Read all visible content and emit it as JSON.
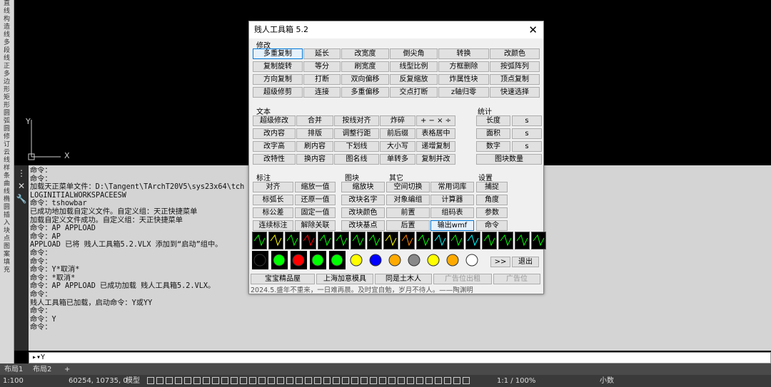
{
  "left_strip": [
    "直",
    "线",
    "构",
    "造",
    "线",
    "多",
    "段",
    "线",
    "正",
    "多",
    "边",
    "形",
    "矩",
    "形",
    "圆",
    "弧",
    "圆",
    "修",
    "订",
    "云",
    "线",
    "样",
    "条",
    "曲",
    "线",
    "椭",
    "圆",
    "插",
    "入",
    "块",
    "点",
    "图",
    "案",
    "填",
    "充"
  ],
  "ucs": {
    "y": "Y",
    "x": "X"
  },
  "cmd_log": [
    "命令：",
    "命令：",
    "加载天正菜单文件：D:\\Tangent\\TArchT20V5\\sys23x64\\tch",
    "LOGINITIALWORKSPACEESW",
    "命令：tshowbar",
    "已成功地加载自定义文件。自定义组：天正快捷菜单",
    "加载自定义文件成功。自定义组：天正快捷菜单",
    "命令：AP APPLOAD",
    "命令：AP",
    "APPLOAD 已将 贱人工具箱5.2.VLX 添加到“启动”组中。",
    "命令：",
    "命令：",
    "命令：Y*取消*",
    "命令：*取消*",
    "命令：AP APPLOAD 已成功加载 贱人工具箱5.2.VLX。",
    "命令：",
    "贱人工具箱已加载，启动命令：Y或YY",
    "命令：",
    "命令：Y",
    "命令："
  ],
  "cmd_input": "Y",
  "layout_tabs": [
    "布局1",
    "布局2",
    "+"
  ],
  "status": {
    "scale": "1:100",
    "coords": "60254, 10735, 0",
    "model": "模型",
    "zoom": "1:1 / 100%",
    "decimal": "小数"
  },
  "dialog": {
    "title": "贱人工具箱 5.2",
    "close": "✕",
    "sections": {
      "modify": "修改",
      "text": "文本",
      "stats": "统计",
      "annot": "标注",
      "block": "图块",
      "other": "其它",
      "settings": "设置"
    },
    "modify": [
      "多重复制",
      "延长",
      "改宽度",
      "倒尖角",
      "转换",
      "改颜色",
      "复制旋转",
      "等分",
      "刷宽度",
      "线型比例",
      "方框删除",
      "按弧阵列",
      "方向复制",
      "打断",
      "双向偏移",
      "反复缩放",
      "炸属性块",
      "顶点复制",
      "超级修剪",
      "连接",
      "多重偏移",
      "交点打断",
      "z轴归零",
      "快速选择"
    ],
    "text": [
      "超级修改",
      "合并",
      "按线对齐",
      "炸碎",
      "+ − × ÷",
      "改内容",
      "排版",
      "调整行距",
      "前后缀",
      "表格居中",
      "改字高",
      "刷内容",
      "下划线",
      "大小写",
      "递增复制",
      "改特性",
      "换内容",
      "图名线",
      "单转多",
      "复制并改"
    ],
    "stats": [
      "长度",
      "s",
      "面积",
      "s",
      "数字",
      "s",
      "图块数量"
    ],
    "annot": [
      "对齐",
      "缩放一值",
      "标弧长",
      "还原一值",
      "标公差",
      "固定一值",
      "连续标注",
      "解除关联"
    ],
    "block": [
      "缩放块",
      "改块名字",
      "改块颜色",
      "改块基点"
    ],
    "other": [
      "空间切换",
      "常用词库",
      "对象编组",
      "计算器",
      "前置",
      "组码表",
      "后置",
      "输出wmf"
    ],
    "settings": [
      "捕捉",
      "角度",
      "参数",
      "命令"
    ],
    "next": ">>",
    "exit": "退出",
    "bottom": [
      "宝宝精品屋",
      "上海加意模具",
      "同是土木人",
      "广告位出租",
      "广告位"
    ],
    "footer": "2024.5.盛年不重来，一日难再晨。及时宜自勉，岁月不待人。——陶渊明"
  }
}
